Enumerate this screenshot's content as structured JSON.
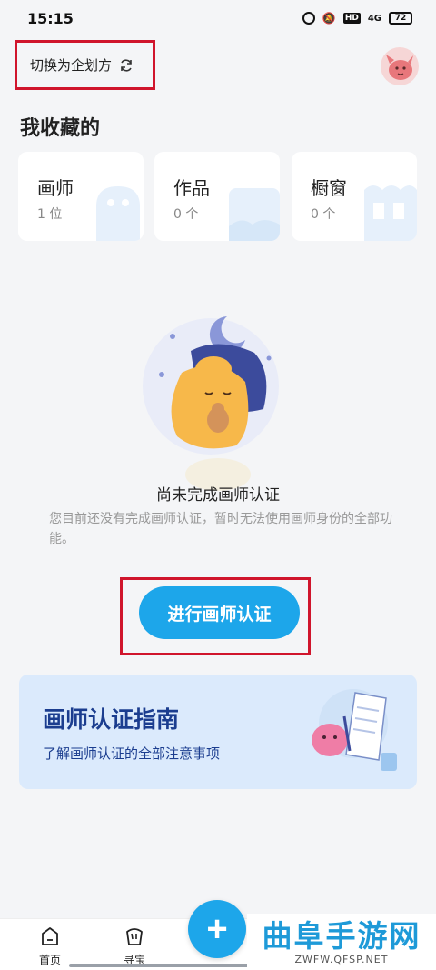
{
  "status_bar": {
    "time": "15:15",
    "hd": "HD",
    "signal": "4G",
    "battery": "72"
  },
  "header": {
    "switch_label": "切换为企划方"
  },
  "favorites": {
    "title": "我收藏的",
    "cards": [
      {
        "label": "画师",
        "count": "1 位"
      },
      {
        "label": "作品",
        "count": "0 个"
      },
      {
        "label": "橱窗",
        "count": "0 个"
      }
    ]
  },
  "empty_state": {
    "title": "尚未完成画师认证",
    "description": "您目前还没有完成画师认证，暂时无法使用画师身份的全部功能。",
    "cta_label": "进行画师认证"
  },
  "guide": {
    "title": "画师认证指南",
    "subtitle": "了解画师认证的全部注意事项"
  },
  "bottom_nav": {
    "items": [
      {
        "label": "首页"
      },
      {
        "label": "寻宝"
      }
    ],
    "plus_label": "+"
  },
  "watermark": {
    "big": "曲阜手游网",
    "small": "ZWFW.QFSP.NET"
  },
  "colors": {
    "accent": "#1da6ea",
    "highlight_border": "#d0152c",
    "guide_bg": "#dbeafc",
    "guide_text": "#1b3d8f"
  }
}
